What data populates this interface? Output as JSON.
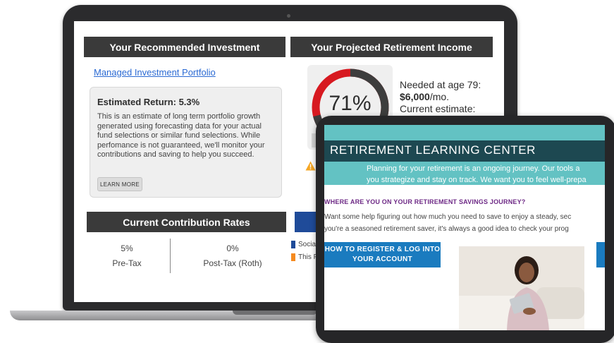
{
  "laptop": {
    "recommended_header": "Your Recommended Investment",
    "projected_header": "Your Projected Retirement Income",
    "portfolio_link": "Managed Investment Portfolio",
    "estimate": {
      "title": "Estimated Return: 5.3%",
      "description": "This is an estimate of long term portfolio growth generated using forecasting data for your actual fund selections or similar fund selections. While perfomance is not guaranteed, we'll monitor your contributions and saving to help you succeed.",
      "learn_more": "LEARN MORE"
    },
    "gauge": {
      "percent_label": "71%",
      "percent_value": 71,
      "colors": {
        "filled": "#3d3d3d",
        "remaining": "#d71920"
      }
    },
    "needed": {
      "line1": "Needed at age 79:",
      "amount": "$6,000",
      "per": "/mo.",
      "line3": "Current estimate:"
    },
    "rates": {
      "header": "Current Contribution Rates",
      "pretax_value": "5%",
      "pretax_label": "Pre-Tax",
      "posttax_value": "0%",
      "posttax_label": "Post-Tax (Roth)"
    },
    "legend": [
      {
        "label": "Socia",
        "color": "#1f4b99"
      },
      {
        "label": "This P",
        "color": "#f58a1f"
      }
    ]
  },
  "tablet": {
    "title": "RETIREMENT LEARNING CENTER",
    "banner_line1": "Planning for your retirement is an ongoing journey. Our tools a",
    "banner_line2": "you strategize and stay on track. We want you to feel well-prepa",
    "journey_heading": "WHERE ARE YOU ON YOUR RETIREMENT SAVINGS JOURNEY?",
    "para_line1": "Want some help figuring out how much you need to save to enjoy a steady, sec",
    "para_line2": "you're a seasoned retirement saver, it's always a good idea to check your prog",
    "register_button": "HOW TO REGISTER & LOG INTO YOUR ACCOUNT",
    "colors": {
      "banner": "#63c2c3",
      "title_bar": "#1d4851",
      "button": "#1a7bbf",
      "heading": "#6e2a86"
    }
  }
}
